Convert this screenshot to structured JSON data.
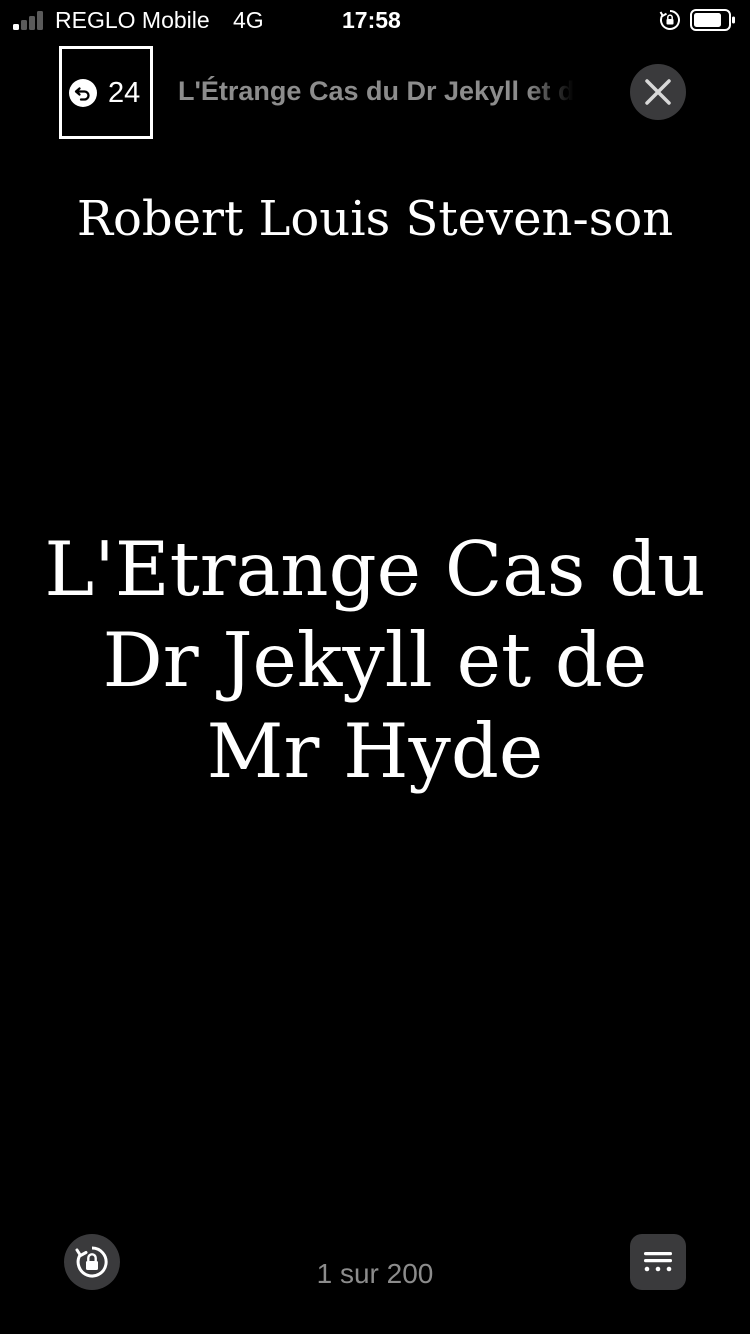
{
  "status_bar": {
    "carrier": "REGLO Mobile",
    "network": "4G",
    "time": "17:58",
    "signal_bars_active": 1,
    "signal_bars_total": 4
  },
  "header": {
    "back_count": "24",
    "title": "L'Étrange Cas du Dr Jekyll et de Mr Hyde"
  },
  "book": {
    "author": "Robert Louis Steven-son",
    "title": "L'Etrange Cas du Dr Jekyll et de Mr Hyde"
  },
  "footer": {
    "page_indicator": "1 sur 200"
  },
  "colors": {
    "background": "#000000",
    "text": "#ffffff",
    "muted_text": "#8c8c8c",
    "button_bg": "#3a3a3c"
  },
  "icons": {
    "back": "back-arrow-icon",
    "close": "close-icon",
    "rotation_lock": "rotation-lock-icon",
    "menu": "menu-dots-icon"
  }
}
